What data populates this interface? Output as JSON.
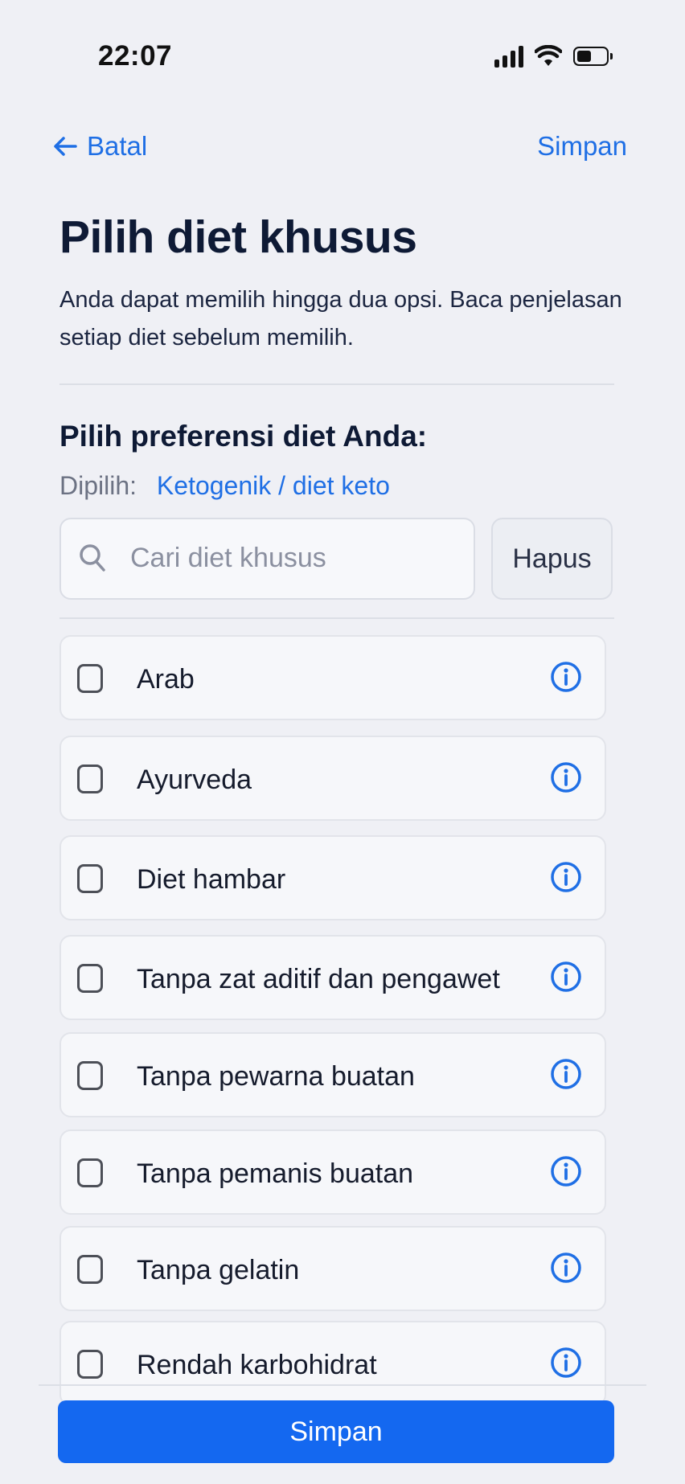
{
  "status_bar": {
    "time": "22:07",
    "battery_level": 0.5
  },
  "nav": {
    "back_label": "Batal",
    "save_label": "Simpan"
  },
  "header": {
    "title": "Pilih diet khusus",
    "subtitle": "Anda dapat memilih hingga dua opsi. Baca penjelasan setiap diet sebelum memilih."
  },
  "section": {
    "title": "Pilih preferensi diet Anda:",
    "selected_label": "Dipilih:",
    "selected_value": "Ketogenik / diet keto"
  },
  "search": {
    "placeholder": "Cari diet khusus",
    "value": "",
    "clear_label": "Hapus"
  },
  "diets": [
    {
      "label": "Arab",
      "checked": false
    },
    {
      "label": "Ayurveda",
      "checked": false
    },
    {
      "label": "Diet hambar",
      "checked": false
    },
    {
      "label": "Tanpa zat aditif dan pengawet",
      "checked": false
    },
    {
      "label": "Tanpa pewarna buatan",
      "checked": false
    },
    {
      "label": "Tanpa pemanis buatan",
      "checked": false
    },
    {
      "label": "Tanpa gelatin",
      "checked": false
    },
    {
      "label": "Rendah karbohidrat",
      "checked": false
    }
  ],
  "footer": {
    "save_label": "Simpan"
  },
  "colors": {
    "accent": "#1f6fe5",
    "button": "#1468f0",
    "background": "#eff0f5"
  }
}
